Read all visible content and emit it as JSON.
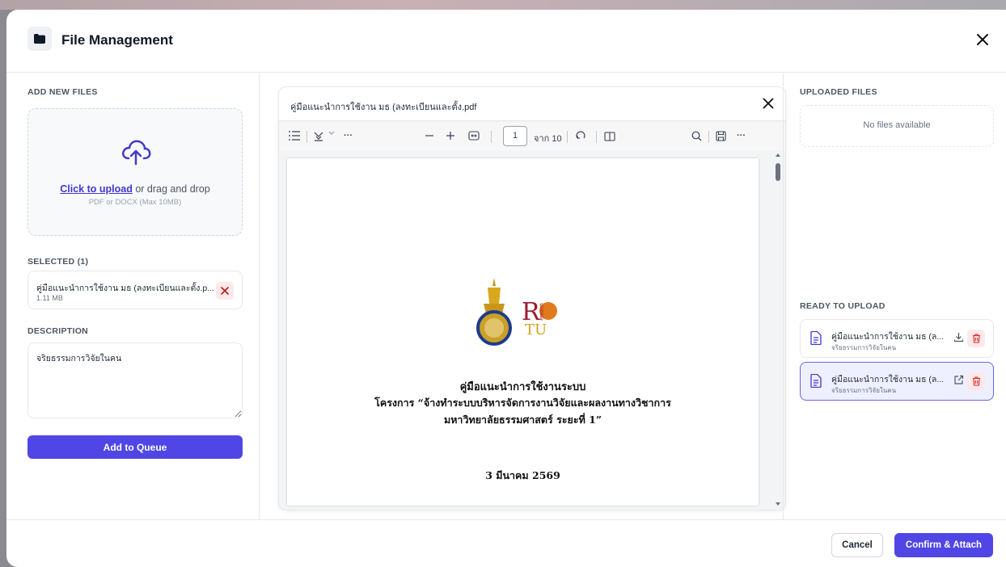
{
  "modal": {
    "title": "File Management"
  },
  "left": {
    "add_label": "ADD NEW FILES",
    "dropzone_link": "Click to upload",
    "dropzone_text": " or drag and drop",
    "dropzone_hint": "PDF or DOCX (Max 10MB)",
    "selected_label": "SELECTED (1)",
    "selected_file": {
      "name": "คู่มือแนะนำการใช้งาน มธ (ลงทะเบียนและตั้ง.p...",
      "size": "1.11 MB"
    },
    "description_label": "DESCRIPTION",
    "description_value": "จริยธรรมการวิจัยในคน",
    "add_button": "Add to Queue"
  },
  "viewer": {
    "title": "คู่มือแนะนำการใช้งาน มธ (ลงทะเบียนและตั้ง.pdf",
    "page_current": "1",
    "page_total": "จาก 10",
    "doc_lines": [
      "คู่มือแนะนำการใช้งานระบบ",
      "โครงการ “จ้างทำระบบบริหารจัดการงานวิจัยและผลงานทางวิชาการ",
      "มหาวิทยาลัยธรรมศาสตร์ ระยะที่ 1”",
      "3 มีนาคม 2569"
    ],
    "logo_text": "RTU",
    "logo_small": "esearch"
  },
  "right": {
    "uploaded_label": "UPLOADED FILES",
    "uploaded_empty": "No files available",
    "ready_label": "READY TO UPLOAD",
    "ready_items": [
      {
        "name": "คู่มือแนะนำการใช้งาน มธ (ล...",
        "desc": "จริยธรรมการวิจัยในคน",
        "action_icon": "download-icon"
      },
      {
        "name": "คู่มือแนะนำการใช้งาน มธ (ล...",
        "desc": "จริยธรรมการวิจัยในคน",
        "action_icon": "external-link-icon"
      }
    ]
  },
  "footer": {
    "cancel": "Cancel",
    "confirm": "Confirm & Attach"
  },
  "colors": {
    "accent": "#4f46e5",
    "danger": "#dc2626",
    "danger_bg": "#fde8ea"
  }
}
